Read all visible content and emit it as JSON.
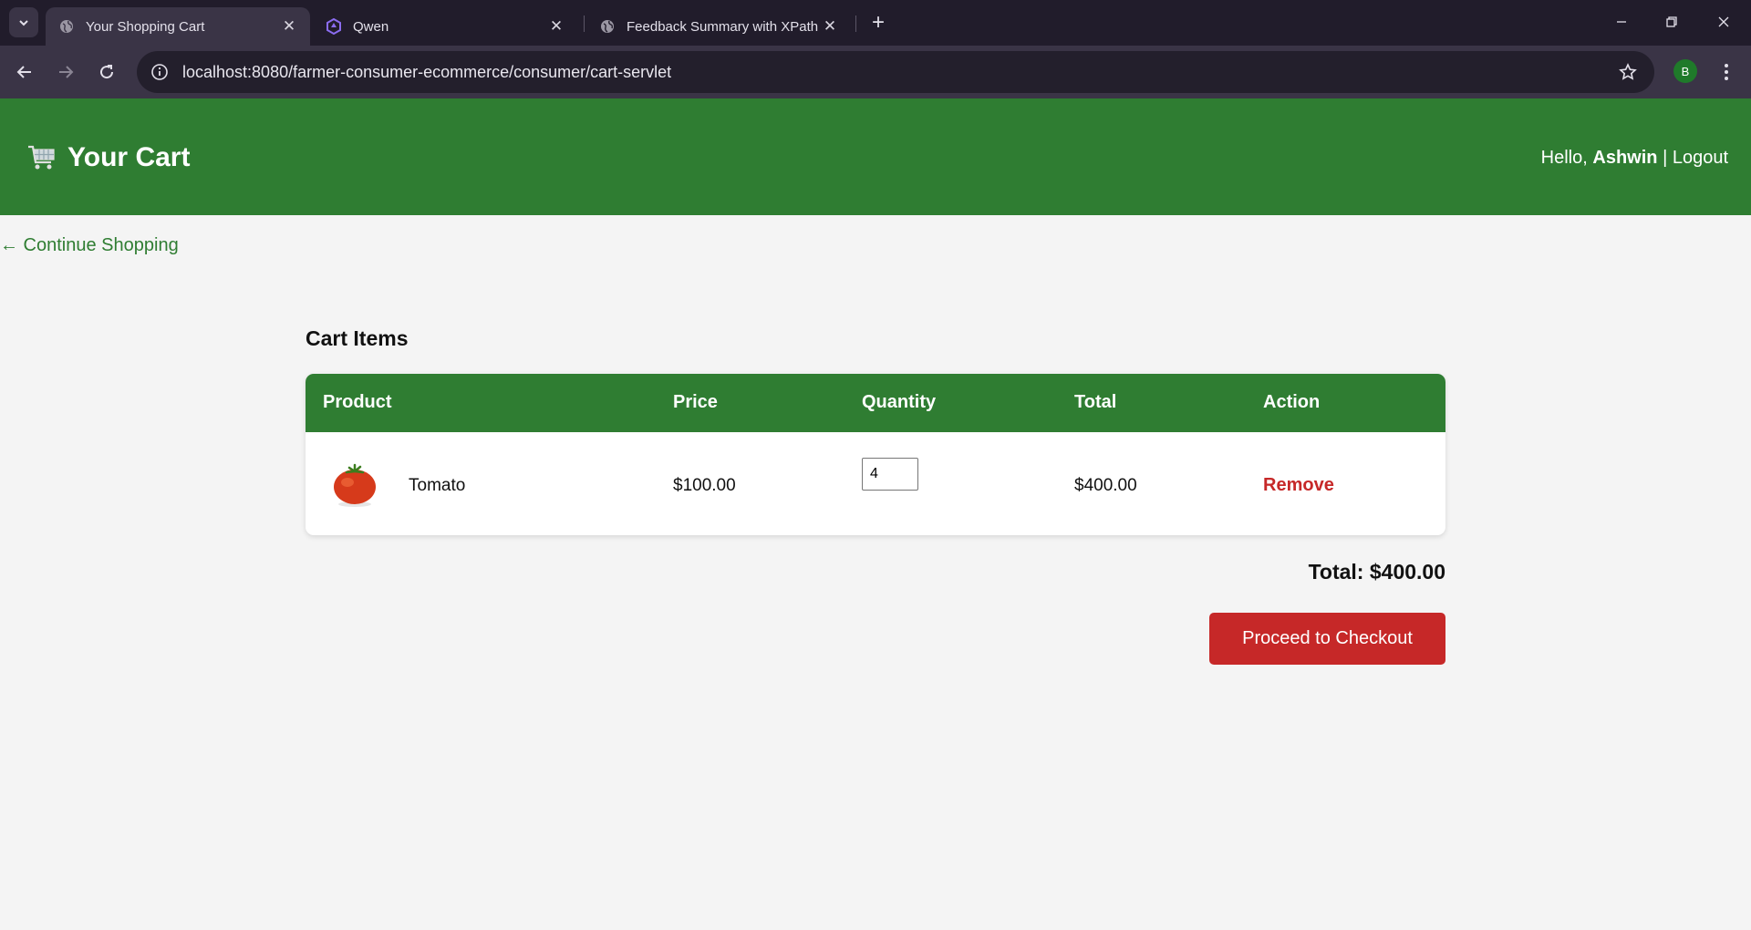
{
  "browser": {
    "tabs": [
      {
        "title": "Your Shopping Cart",
        "icon": "globe-icon",
        "active": true
      },
      {
        "title": "Qwen",
        "icon": "qwen-logo-icon",
        "active": false
      },
      {
        "title": "Feedback Summary with XPath",
        "icon": "globe-icon",
        "active": false
      }
    ],
    "new_tab_label": "+",
    "url": "localhost:8080/farmer-consumer-ecommerce/consumer/cart-servlet",
    "profile_initial": "B",
    "accent_color": "#1f7a2a"
  },
  "header": {
    "title": "Your Cart",
    "greeting": "Hello,",
    "username": "Ashwin",
    "separator": "|",
    "logout": "Logout",
    "background": "#2f7d32"
  },
  "continue_link": "← Continue Shopping",
  "cart": {
    "section_title": "Cart Items",
    "columns": [
      "Product",
      "Price",
      "Quantity",
      "Total",
      "Action"
    ],
    "rows": [
      {
        "product": "Tomato",
        "price": "$100.00",
        "quantity": "4",
        "total": "$400.00",
        "action": "Remove"
      }
    ],
    "grand_total": "Total: $400.00",
    "checkout_label": "Proceed to Checkout",
    "remove_color": "#c62828"
  }
}
